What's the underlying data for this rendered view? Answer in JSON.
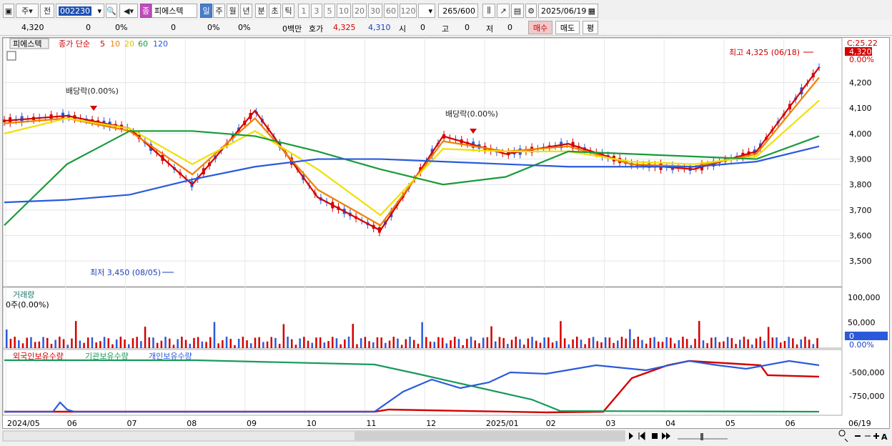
{
  "toolbar": {
    "period_mode": "주",
    "prev_label": "전",
    "stock_code": "002230",
    "stock_name": "피에스텍",
    "stock_badge": "종",
    "intervals": [
      "일",
      "주",
      "월",
      "년",
      "분",
      "초",
      "틱"
    ],
    "numbers": [
      "1",
      "3",
      "5",
      "10",
      "20",
      "30",
      "60",
      "120"
    ],
    "count_current": "265",
    "count_total": "/600",
    "date": "2025/06/19"
  },
  "quote": {
    "price": "4,320",
    "change": "0",
    "change_pct": "0%",
    "volume": "0",
    "vol_pct": "0%",
    "vol_pct2": "0%",
    "amount": "0백만",
    "hoga_label": "호가",
    "ask": "4,325",
    "bid": "4,310",
    "open_label": "시",
    "open": "0",
    "high_label": "고",
    "high": "0",
    "low_label": "저",
    "low": "0",
    "buy_label": "매수",
    "sell_label": "매도",
    "avg_label": "평"
  },
  "price_panel": {
    "name": "피에스텍",
    "ma_label": "종가 단순",
    "ma_periods": [
      "5",
      "10",
      "20",
      "60",
      "120"
    ],
    "ma_colors": [
      "#d40000",
      "#f08000",
      "#f0e000",
      "#1a9a3a",
      "#2a5adc"
    ],
    "top_right_label": "C:25.22",
    "current_price_tag": "4,320",
    "current_pct_tag": "0.00%",
    "max_annotation": "최고 4,325 (06/18)",
    "min_annotation": "최저 3,450 (08/05)",
    "dividend_annotations": [
      "배당락(0.00%)",
      "배당락(0.00%)"
    ],
    "y_ticks": [
      "4,200",
      "4,100",
      "4,000",
      "3,900",
      "3,800",
      "3,700",
      "3,600",
      "3,500"
    ]
  },
  "volume_panel": {
    "name": "거래량",
    "readout": "0주(0.00%)",
    "y_ticks": [
      "100,000",
      "50,000"
    ],
    "current_tag": "0",
    "pct_tag": "0.00%"
  },
  "holdings_panel": {
    "series": [
      "외국인보유수량",
      "기관보유수량",
      "개인보유수량"
    ],
    "colors": [
      "#d40000",
      "#1a9a5a",
      "#2a5adc"
    ],
    "y_ticks": [
      "-500,000",
      "-750,000"
    ]
  },
  "x_axis": {
    "labels": [
      "2024/05",
      "06",
      "07",
      "08",
      "09",
      "10",
      "11",
      "12",
      "2025/01",
      "02",
      "03",
      "04",
      "05",
      "06"
    ],
    "end_label": "06/19"
  },
  "chart_data": {
    "type": "line",
    "title": "피에스텍",
    "ylim": [
      3450,
      4325
    ],
    "x": [
      "2024/05",
      "06",
      "07",
      "08",
      "09",
      "10",
      "11",
      "12",
      "2025/01",
      "02",
      "03",
      "04",
      "05",
      "06"
    ],
    "series": [
      {
        "name": "5",
        "values": [
          4050,
          4070,
          4020,
          3800,
          4090,
          3750,
          3620,
          3990,
          3920,
          3960,
          3880,
          3860,
          3930,
          4260
        ]
      },
      {
        "name": "10",
        "values": [
          4040,
          4060,
          4010,
          3840,
          4060,
          3780,
          3640,
          3970,
          3930,
          3950,
          3880,
          3870,
          3920,
          4220
        ]
      },
      {
        "name": "20",
        "values": [
          4000,
          4060,
          4020,
          3880,
          4010,
          3860,
          3680,
          3940,
          3930,
          3930,
          3890,
          3880,
          3910,
          4130
        ]
      },
      {
        "name": "60",
        "values": [
          3640,
          3880,
          4010,
          4010,
          3990,
          3930,
          3860,
          3800,
          3830,
          3930,
          3920,
          3910,
          3900,
          3990
        ]
      },
      {
        "name": "120",
        "values": [
          3730,
          3740,
          3760,
          3820,
          3870,
          3900,
          3900,
          3890,
          3880,
          3870,
          3870,
          3870,
          3890,
          3950
        ]
      }
    ]
  }
}
